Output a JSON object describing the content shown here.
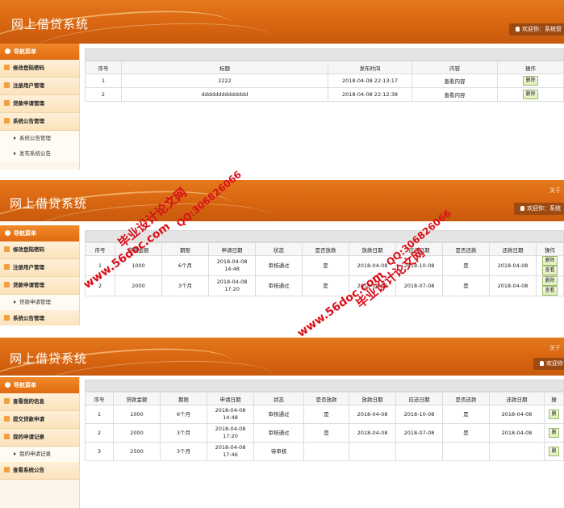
{
  "app_title": "网上借贷系统",
  "about": "关于",
  "welcome_prefix": "欢迎你：",
  "panel1": {
    "welcome": "欢迎你：系统管",
    "nav_head": "导航菜单",
    "menu": [
      "修改登陆密码",
      "注册用户管理",
      "贷款申请管理",
      "系统公告管理"
    ],
    "submenu": [
      "系统公告管理",
      "发布系统公告"
    ],
    "columns": [
      "序号",
      "标题",
      "发布时间",
      "内容",
      "操作"
    ],
    "rows": [
      {
        "no": "1",
        "title": "2222",
        "time": "2018-04-08 22:13:17",
        "content": "查看内容",
        "action": "删除"
      },
      {
        "no": "2",
        "title": "dddddddddddddd",
        "time": "2018-04-08 22:12:38",
        "content": "查看内容",
        "action": "删除"
      }
    ]
  },
  "panel2": {
    "welcome": "欢迎你：系统",
    "nav_head": "导航菜单",
    "menu": [
      "修改登陆密码",
      "注册用户管理",
      "贷款申请管理"
    ],
    "submenu": [
      "贷款申请管理"
    ],
    "menu_last": "系统公告管理",
    "columns": [
      "序号",
      "贷款金额",
      "期限",
      "申请日期",
      "状态",
      "是否放款",
      "放款日期",
      "应还日期",
      "是否还款",
      "还款日期",
      "操作"
    ],
    "rows": [
      {
        "no": "1",
        "amount": "1000",
        "term": "6个月",
        "apply_date": "2018-04-08 14:48",
        "status": "审核通过",
        "lent": "是",
        "lend_date": "2018-04-08",
        "due_date": "2018-10-08",
        "repaid": "是",
        "repay_date": "2018-04-08",
        "actions": [
          "删除",
          "查看"
        ]
      },
      {
        "no": "2",
        "amount": "2000",
        "term": "3个月",
        "apply_date": "2018-04-08 17:20",
        "status": "审核通过",
        "lent": "是",
        "lend_date": "2018-04-08",
        "due_date": "2018-07-08",
        "repaid": "是",
        "repay_date": "2018-04-08",
        "actions": [
          "删除",
          "查看"
        ]
      }
    ]
  },
  "panel3": {
    "welcome": "欢迎你",
    "nav_head": "导航菜单",
    "menu": [
      "查看我的信息",
      "提交贷款申请",
      "我的申请记录"
    ],
    "submenu": [
      "我的申请记录"
    ],
    "menu_last": "查看系统公告",
    "columns": [
      "序号",
      "贷款金额",
      "期限",
      "申请日期",
      "状态",
      "是否放款",
      "放款日期",
      "应还日期",
      "是否还款",
      "还款日期",
      "操"
    ],
    "rows": [
      {
        "no": "1",
        "amount": "1000",
        "term": "6个月",
        "apply_date": "2018-04-08 14:48",
        "status": "审核通过",
        "lent": "是",
        "lend_date": "2018-04-08",
        "due_date": "2018-10-08",
        "repaid": "是",
        "repay_date": "2018-04-08",
        "action": "删"
      },
      {
        "no": "2",
        "amount": "2000",
        "term": "3个月",
        "apply_date": "2018-04-08 17:20",
        "status": "审核通过",
        "lent": "是",
        "lend_date": "2018-04-08",
        "due_date": "2018-07-08",
        "repaid": "是",
        "repay_date": "2018-04-08",
        "action": "删"
      },
      {
        "no": "3",
        "amount": "2500",
        "term": "3个月",
        "apply_date": "2018-04-08 17:46",
        "status": "待审核",
        "lent": "",
        "lend_date": "",
        "due_date": "",
        "repaid": "",
        "repay_date": "",
        "action": "删"
      }
    ]
  },
  "watermarks": {
    "site": "www.56doc.com",
    "slogan": "毕业设计论文网",
    "qq": "QQ:306826066"
  },
  "colors": {
    "header": "#d86510",
    "nav_head": "#e8781a",
    "watermark": "#d9101a"
  }
}
